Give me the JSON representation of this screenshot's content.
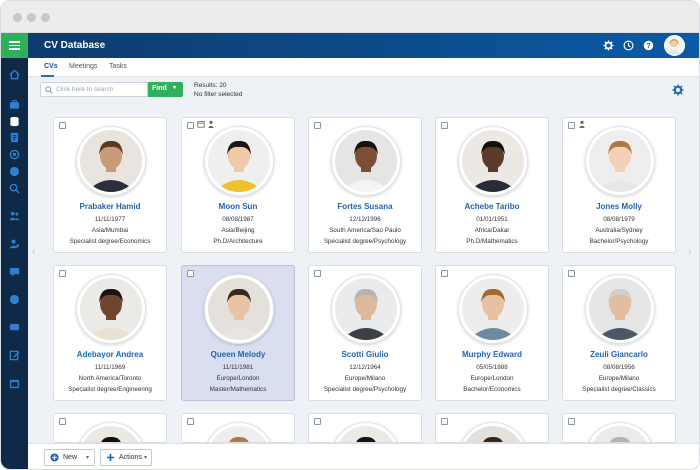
{
  "app": {
    "title": "CV Database"
  },
  "tabs": [
    {
      "label": "CVs",
      "active": true
    },
    {
      "label": "Meetings",
      "active": false
    },
    {
      "label": "Tasks",
      "active": false
    }
  ],
  "search": {
    "placeholder": "Click here to search",
    "find_label": "Find"
  },
  "results": {
    "count_text": "Results: 20",
    "filter_text": "No filter selected"
  },
  "cards": [
    {
      "name": "Prabaker Hamid",
      "date": "11/11/1977",
      "location": "Asia/Mumbai",
      "degree": "Specialist degree/Economics",
      "selected": false,
      "icons": []
    },
    {
      "name": "Moon Sun",
      "date": "08/08/1987",
      "location": "Asia/Beijing",
      "degree": "Ph.D/Architecture",
      "selected": false,
      "icons": [
        "calendar-icon",
        "person-icon"
      ]
    },
    {
      "name": "Fortes Susana",
      "date": "12/12/1996",
      "location": "South America/Sao Paulo",
      "degree": "Specialist degree/Psychology",
      "selected": false,
      "icons": []
    },
    {
      "name": "Achebe Taribo",
      "date": "01/01/1951",
      "location": "Africa/Dakar",
      "degree": "Ph.D/Mathematics",
      "selected": false,
      "icons": []
    },
    {
      "name": "Jones Molly",
      "date": "08/08/1979",
      "location": "Australia/Sydney",
      "degree": "Bachelor/Psychology",
      "selected": false,
      "icons": [
        "person-icon"
      ]
    },
    {
      "name": "Adebayor Andrea",
      "date": "11/11/1969",
      "location": "North America/Toronto",
      "degree": "Specialist degree/Engineering",
      "selected": false,
      "icons": []
    },
    {
      "name": "Queen Melody",
      "date": "11/11/1981",
      "location": "Europe/London",
      "degree": "Master/Mathematics",
      "selected": true,
      "icons": []
    },
    {
      "name": "Scotti Giulio",
      "date": "12/12/1964",
      "location": "Europe/Milano",
      "degree": "Specialist degree/Psychology",
      "selected": false,
      "icons": []
    },
    {
      "name": "Murphy Edward",
      "date": "05/05/1988",
      "location": "Europe/London",
      "degree": "Bachelor/Economics",
      "selected": false,
      "icons": []
    },
    {
      "name": "Zeuli Giancarlo",
      "date": "08/08/1956",
      "location": "Europe/Milano",
      "degree": "Specialist degree/Classics",
      "selected": false,
      "icons": []
    }
  ],
  "bottom": {
    "new_label": "New",
    "actions_label": "Actions"
  },
  "colors": {
    "accent_green": "#2eb15a",
    "header_blue": "#0a5aa8",
    "name_blue": "#1e63b0",
    "sidebar": "#0e2a47",
    "selected_card": "#d9def0"
  }
}
